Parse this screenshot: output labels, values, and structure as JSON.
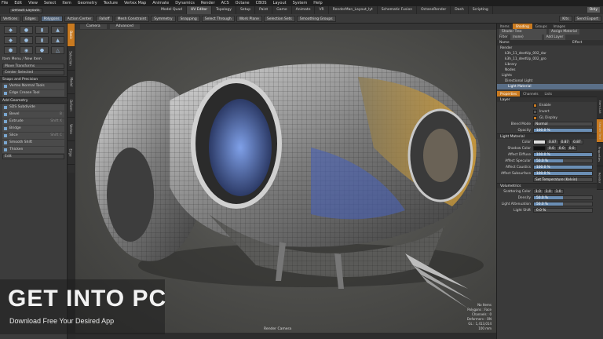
{
  "menu": [
    "File",
    "Edit",
    "View",
    "Select",
    "Item",
    "Geometry",
    "Texture",
    "Vertex Map",
    "Animate",
    "Dynamics",
    "Render",
    "ACS",
    "Octane",
    "CBOS",
    "Layout",
    "System",
    "Help"
  ],
  "layout": {
    "selector": "Default Layouts",
    "tabs": [
      "Model Quad",
      "UV Editor",
      "Topology",
      "Setup",
      "Paint",
      "Game",
      "Animate",
      "VR",
      "RenderMan_Layout_lyt",
      "Schematic Fusion",
      "OctaneRender",
      "Dash",
      "Scripting"
    ],
    "active_tab": "UV Editor",
    "only_label": "Only"
  },
  "toolbar": {
    "buttons": [
      "Vertices",
      "Edges",
      "Polygons",
      "Action Center",
      "Falloff",
      "Mesh Constraint",
      "Symmetry",
      "Snapping",
      "Select Through",
      "Work Plane",
      "Selection Sets",
      "Smoothing Groups"
    ],
    "right_buttons": [
      "Kits",
      "Send Export"
    ],
    "highlighted": [
      "Polygons"
    ]
  },
  "left_panel": {
    "icon_rows": [
      [
        "◆",
        "●",
        "▮",
        "▲"
      ],
      [
        "◆",
        "●",
        "▮",
        "▲"
      ],
      [
        "⬢",
        "◉",
        "⬣",
        "△"
      ]
    ],
    "item_menu": "Item Menu / New Item",
    "transform_header": "Move Transforms",
    "center_selected": "Center Selected",
    "snap_precision": "Snaps and Precision",
    "vertex_tools": [
      "Vertex Normal Tools",
      "Edge Crease Tool"
    ],
    "add_geometry": "Add Geometry",
    "tools": [
      {
        "name": "SDS Subdivide",
        "shortcut": ""
      },
      {
        "name": "Bevel",
        "shortcut": "B"
      },
      {
        "name": "Extrude",
        "shortcut": "Shift X"
      },
      {
        "name": "Bridge",
        "shortcut": ""
      },
      {
        "name": "Slice",
        "shortcut": "Shift C"
      },
      {
        "name": "Smooth Shift",
        "shortcut": ""
      },
      {
        "name": "Thicken",
        "shortcut": ""
      }
    ],
    "edit": "Edit",
    "side_tabs": [
      "Basic",
      "Selection",
      "Model",
      "Deform",
      "Vertex",
      "Edge",
      "Polygon",
      "Curves",
      "Mesh Ops"
    ]
  },
  "viewport": {
    "tabs": [
      "Camera",
      "Advanced"
    ],
    "camera_label": "Render Camera",
    "info": [
      "No Items",
      "Polygons : Face",
      "Channels : 0",
      "Deformers : ON",
      "GL : 1,413,014",
      "100 mm"
    ]
  },
  "right_panel": {
    "top_tabs": [
      "Items",
      "Shading",
      "Groups",
      "Images"
    ],
    "active_top_tab": "Shading",
    "view_label": "Shader Tree",
    "assign_label": "Assign Material",
    "filter_label": "Filter",
    "filter_value": "(none)",
    "add_layer": "Add Layer",
    "tree_cols": [
      "Name",
      "Effect"
    ],
    "tree_items": [
      "Render",
      "k3h_11_deetUp_002_dar",
      "k3h_11_deetUp_002_gro",
      "Library",
      "Nodes",
      "Lights",
      "Directional Light",
      "Light Material"
    ],
    "selected_item": "Light Material",
    "prop_tabs": [
      "Properties",
      "Channels",
      "Lists"
    ],
    "layer_section": "Layer",
    "enable_label": "Enable",
    "invert_label": "Invert",
    "gl_display_label": "GL Display",
    "blend_mode_label": "Blend Mode",
    "blend_mode_value": "Normal",
    "opacity_label": "Opacity",
    "opacity_value": "100.0 %",
    "opacity_pct": 100,
    "light_material_section": "Light Material",
    "color_label": "Color",
    "color_values": [
      "0.87",
      "0.87",
      "0.87"
    ],
    "shadow_color_label": "Shadow Color",
    "shadow_values": [
      "0.0",
      "0.0",
      "0.0"
    ],
    "affect_rows": [
      {
        "label": "Affect Diffuse",
        "value": "100.0 %",
        "pct": 100
      },
      {
        "label": "Affect Specular",
        "value": "50.0 %",
        "pct": 50
      },
      {
        "label": "Affect Caustics",
        "value": "100.0 %",
        "pct": 100
      },
      {
        "label": "Affect Subsurface",
        "value": "100.0 %",
        "pct": 100
      }
    ],
    "set_temperature": "Set Temperature (Kelvin)",
    "volumetrics_section": "Volumetrics",
    "scattering_label": "Scattering Color",
    "scattering_values": [
      "1.0",
      "1.0",
      "1.0"
    ],
    "density_label": "Density",
    "density_value": "50.0 %",
    "density_pct": 50,
    "attenuation_label": "Light Attenuation",
    "attenuation_value": "50.0 %",
    "attenuation_pct": 50,
    "shift_label": "Light Shift",
    "shift_value": "0.0 %",
    "shift_pct": 0,
    "side_tabs": [
      "Item List",
      "Shader Tree",
      "Properties",
      "Render"
    ]
  },
  "watermark": {
    "title": "GET INTO PC",
    "subtitle": "Download Free Your Desired App"
  }
}
